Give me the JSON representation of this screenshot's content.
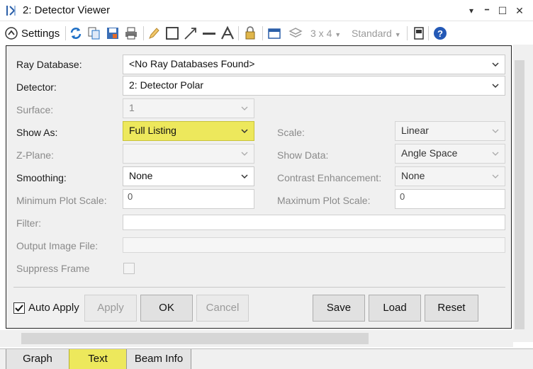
{
  "window": {
    "title": "2: Detector Viewer",
    "controls": {
      "pin": "▾",
      "minimize": "━",
      "maximize": "☐",
      "close": "✕"
    }
  },
  "toolbar": {
    "settings_label": "Settings",
    "layout_label": "3 x 4",
    "style_label": "Standard",
    "icons": [
      "settings-icon",
      "refresh-icon",
      "copy-icon",
      "save-icon",
      "print-icon",
      "pencil-icon",
      "rectangle-icon",
      "arrow-icon",
      "line-icon",
      "text-icon",
      "lock-icon",
      "window-icon",
      "layers-icon",
      "panel-icon",
      "help-icon"
    ]
  },
  "form": {
    "ray_database": {
      "label": "Ray Database:",
      "value": "<No Ray Databases Found>"
    },
    "detector": {
      "label": "Detector:",
      "value": "2: Detector Polar"
    },
    "surface": {
      "label": "Surface:",
      "value": "1"
    },
    "show_as": {
      "label": "Show As:",
      "value": "Full Listing"
    },
    "scale": {
      "label": "Scale:",
      "value": "Linear"
    },
    "z_plane": {
      "label": "Z-Plane:",
      "value": ""
    },
    "show_data": {
      "label": "Show Data:",
      "value": "Angle Space"
    },
    "smoothing": {
      "label": "Smoothing:",
      "value": "None"
    },
    "contrast": {
      "label": "Contrast Enhancement:",
      "value": "None"
    },
    "min_plot_scale": {
      "label": "Minimum Plot Scale:",
      "value": "0"
    },
    "max_plot_scale": {
      "label": "Maximum Plot Scale:",
      "value": "0"
    },
    "filter": {
      "label": "Filter:",
      "value": ""
    },
    "output_image": {
      "label": "Output Image File:",
      "value": ""
    },
    "suppress_frame": {
      "label": "Suppress Frame",
      "checked": false
    }
  },
  "buttons": {
    "auto_apply_label": "Auto Apply",
    "auto_apply_checked": true,
    "apply": "Apply",
    "ok": "OK",
    "cancel": "Cancel",
    "save": "Save",
    "load": "Load",
    "reset": "Reset"
  },
  "tabs": [
    {
      "label": "Graph",
      "active": false
    },
    {
      "label": "Text",
      "active": true
    },
    {
      "label": "Beam Info",
      "active": false
    }
  ],
  "colors": {
    "highlight": "#ede85c",
    "accent_blue": "#1f6fc5"
  }
}
